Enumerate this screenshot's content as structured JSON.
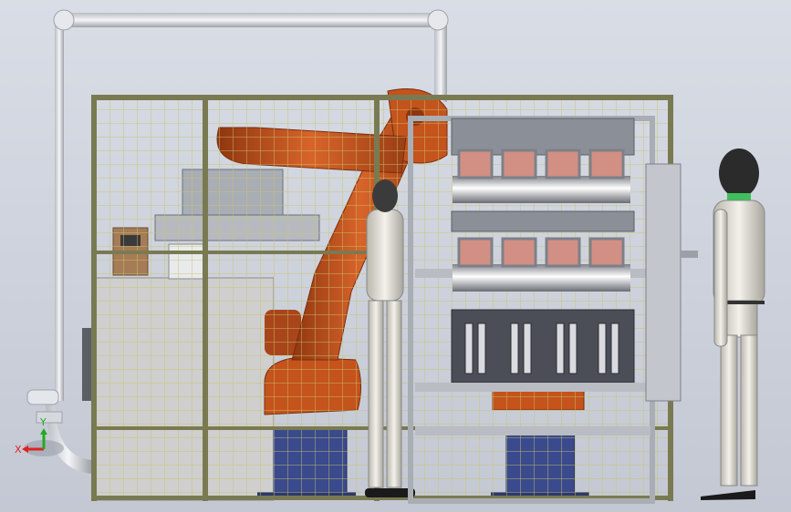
{
  "scene": {
    "background_top": "#d9dde6",
    "background_bottom": "#c3c8d3"
  },
  "colors": {
    "pipe": "#e3e6ea",
    "fence_frame": "#7a7a52",
    "fence_mesh": "#c9c46a",
    "robot": "#c4531c",
    "robot_dark": "#8f3610",
    "pedestal": "#3a4a8c",
    "machine_frame": "#a9adb4",
    "machine_panel": "#4b4e57",
    "cabinet": "#cfcfcf",
    "human": "#e9e6dc",
    "human_head": "#2b2b2b",
    "collar": "#3fbf5a",
    "axis_x": "#d22",
    "axis_y": "#2a2",
    "axis_z": "#22b"
  },
  "triad": {
    "x_label": "X",
    "y_label": "Y"
  }
}
